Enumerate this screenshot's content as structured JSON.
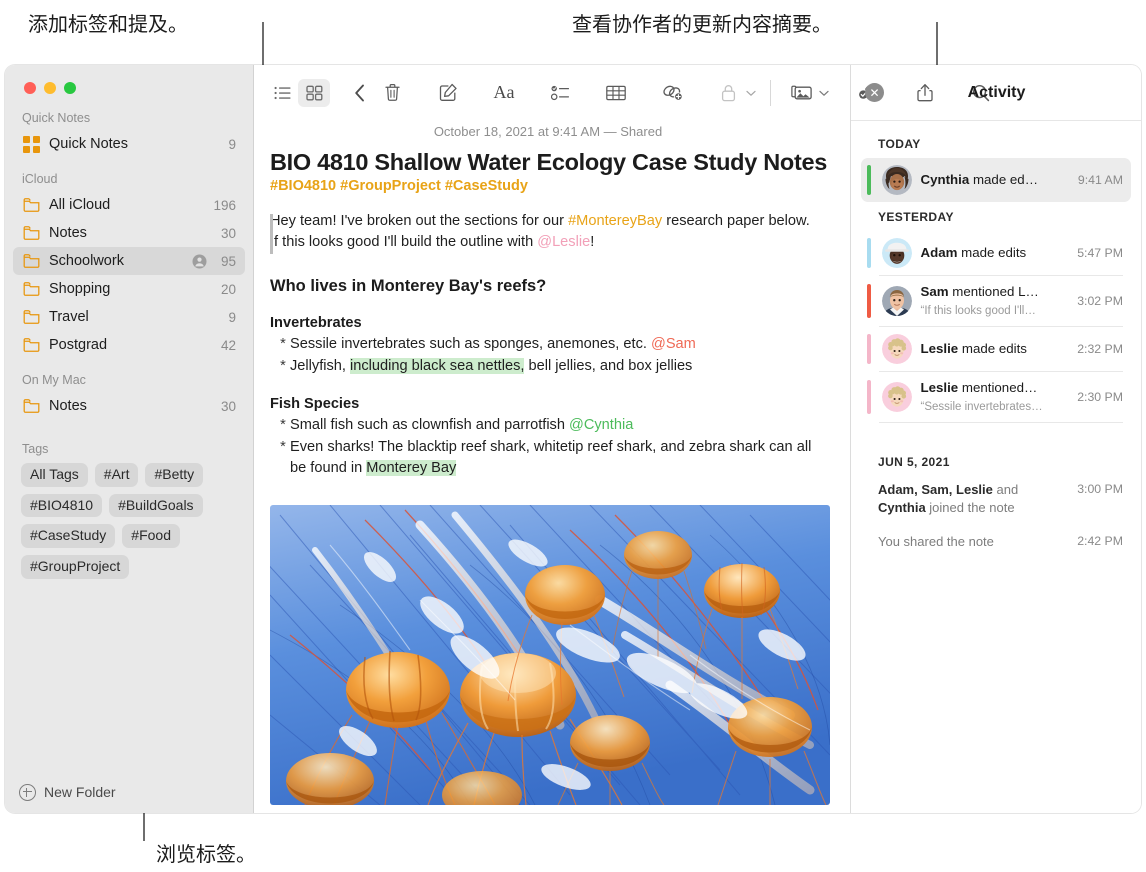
{
  "callouts": {
    "top_left": "添加标签和提及。",
    "top_right": "查看协作者的更新内容摘要。",
    "bottom": "浏览标签。"
  },
  "sidebar": {
    "sections": [
      {
        "title": "Quick Notes",
        "rows": [
          {
            "label": "Quick Notes",
            "count": "9",
            "icon": "quicknotes-grid-icon",
            "selected": false,
            "shared": false
          }
        ]
      },
      {
        "title": "iCloud",
        "rows": [
          {
            "label": "All iCloud",
            "count": "196",
            "icon": "folder-icon",
            "selected": false,
            "shared": false
          },
          {
            "label": "Notes",
            "count": "30",
            "icon": "folder-icon",
            "selected": false,
            "shared": false
          },
          {
            "label": "Schoolwork",
            "count": "95",
            "icon": "folder-icon",
            "selected": true,
            "shared": true
          },
          {
            "label": "Shopping",
            "count": "20",
            "icon": "folder-icon",
            "selected": false,
            "shared": false
          },
          {
            "label": "Travel",
            "count": "9",
            "icon": "folder-icon",
            "selected": false,
            "shared": false
          },
          {
            "label": "Postgrad",
            "count": "42",
            "icon": "folder-icon",
            "selected": false,
            "shared": false
          }
        ]
      },
      {
        "title": "On My Mac",
        "rows": [
          {
            "label": "Notes",
            "count": "30",
            "icon": "folder-icon",
            "selected": false,
            "shared": false
          }
        ]
      }
    ],
    "tags_title": "Tags",
    "tags": [
      "All Tags",
      "#Art",
      "#Betty",
      "#BIO4810",
      "#BuildGoals",
      "#CaseStudy",
      "#Food",
      "#GroupProject"
    ],
    "new_folder_label": "New Folder"
  },
  "toolbar": {
    "list_view": "list-view-icon",
    "gallery_view": "gallery-view-icon",
    "back": "back-chevron-icon",
    "delete": "trash-icon",
    "compose": "compose-icon",
    "format": "Aa",
    "checklist": "checklist-icon",
    "table": "table-icon",
    "link": "add-link-icon",
    "lock": "lock-icon",
    "media": "media-icon",
    "collaborate": "collaborate-icon",
    "share": "share-icon",
    "search": "search-icon"
  },
  "note": {
    "date": "October 18, 2021 at 9:41 AM — Shared",
    "title": "BIO 4810 Shallow Water Ecology Case Study Notes",
    "hashtags": "#BIO4810 #GroupProject #CaseStudy",
    "intro": {
      "part1": "Hey team! I've broken out the sections for our ",
      "tag": "#MontereyBay",
      "part2": " research paper below. If this looks good I'll build the outline with ",
      "mention": "@Leslie",
      "part3": "!"
    },
    "heading": "Who lives in Monterey Bay's reefs?",
    "sections": [
      {
        "title": "Invertebrates",
        "items": [
          {
            "segments": [
              {
                "text": "Sessile invertebrates such as sponges, anemones, etc. ",
                "style": "plain"
              },
              {
                "text": "@Sam",
                "style": "mention-sam"
              }
            ]
          },
          {
            "segments": [
              {
                "text": "Jellyfish, ",
                "style": "plain"
              },
              {
                "text": "including black sea nettles,",
                "style": "highlight"
              },
              {
                "text": " bell jellies, and box jellies",
                "style": "plain"
              }
            ]
          }
        ]
      },
      {
        "title": "Fish Species",
        "items": [
          {
            "segments": [
              {
                "text": "Small fish such as clownfish and parrotfish ",
                "style": "plain"
              },
              {
                "text": "@Cynthia",
                "style": "mention-cynthia"
              }
            ]
          },
          {
            "segments": [
              {
                "text": "Even sharks! The blacktip reef shark, whitetip reef shark, and zebra shark can all be found in ",
                "style": "plain"
              },
              {
                "text": "Monterey Bay",
                "style": "highlight"
              }
            ]
          }
        ]
      }
    ],
    "image_alt": "jellyfish-photo"
  },
  "activity": {
    "title": "Activity",
    "close": "close-icon",
    "groups": [
      {
        "day": "TODAY",
        "entries": [
          {
            "name": "Cynthia",
            "action": " made ed…",
            "quote": "",
            "time": "9:41 AM",
            "color": "#4cbb5b",
            "avatar": "cynthia",
            "selected": true
          }
        ]
      },
      {
        "day": "YESTERDAY",
        "entries": [
          {
            "name": "Adam",
            "action": " made edits",
            "quote": "",
            "time": "5:47 PM",
            "color": "#a8dcf0",
            "avatar": "adam",
            "selected": false
          },
          {
            "name": "Sam",
            "action": " mentioned L…",
            "quote": "“If this looks good I'll…",
            "time": "3:02 PM",
            "color": "#ef5b44",
            "avatar": "sam",
            "selected": false
          },
          {
            "name": "Leslie",
            "action": " made edits",
            "quote": "",
            "time": "2:32 PM",
            "color": "#f4b6c9",
            "avatar": "leslie",
            "selected": false
          },
          {
            "name": "Leslie",
            "action": " mentioned…",
            "quote": "“Sessile invertebrates…",
            "time": "2:30 PM",
            "color": "#f4b6c9",
            "avatar": "leslie",
            "selected": false
          }
        ]
      }
    ],
    "older": {
      "day": "JUN 5, 2021",
      "entries": [
        {
          "names": "Adam, Sam, Leslie",
          "conj": " and ",
          "names2": "Cynthia",
          "tail": " joined the note",
          "time": "3:00 PM"
        }
      ],
      "shared": {
        "text": "You shared the note",
        "time": "2:42 PM"
      }
    }
  },
  "colors": {
    "accent_orange": "#e8960c",
    "tag_orange": "#e8a317",
    "highlight_green": "#cdeccd",
    "mention_sam": "#ef6a56",
    "mention_cynthia": "#4cbb5b",
    "mention_leslie": "#f2a0b8"
  }
}
